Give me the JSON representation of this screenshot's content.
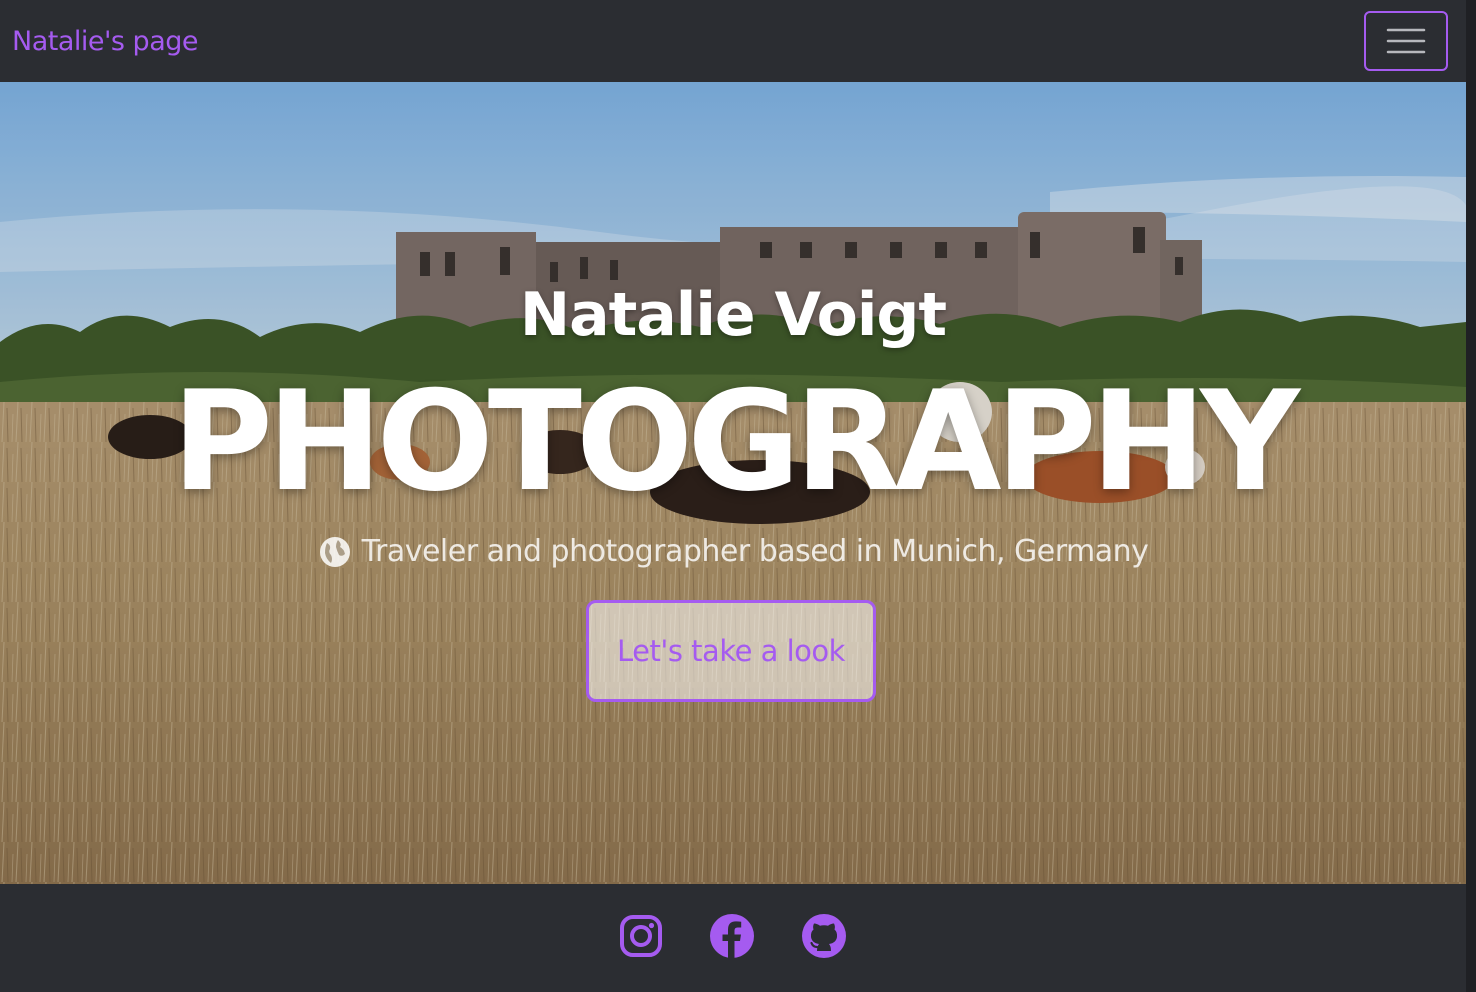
{
  "navbar": {
    "brand": "Natalie's page",
    "toggler_icon": "hamburger-menu-icon"
  },
  "hero": {
    "name": "Natalie Voigt",
    "title": "PHOTOGRAPHY",
    "tagline_icon": "globe-icon",
    "tagline": "Traveler and photographer based in Munich, Germany",
    "cta_label": "Let's take a look"
  },
  "footer": {
    "social_links": [
      {
        "icon": "instagram-icon"
      },
      {
        "icon": "facebook-icon"
      },
      {
        "icon": "github-icon"
      }
    ]
  },
  "colors": {
    "accent": "#a55bf0",
    "dark": "#2b2d32",
    "text_light": "#ffffff"
  }
}
